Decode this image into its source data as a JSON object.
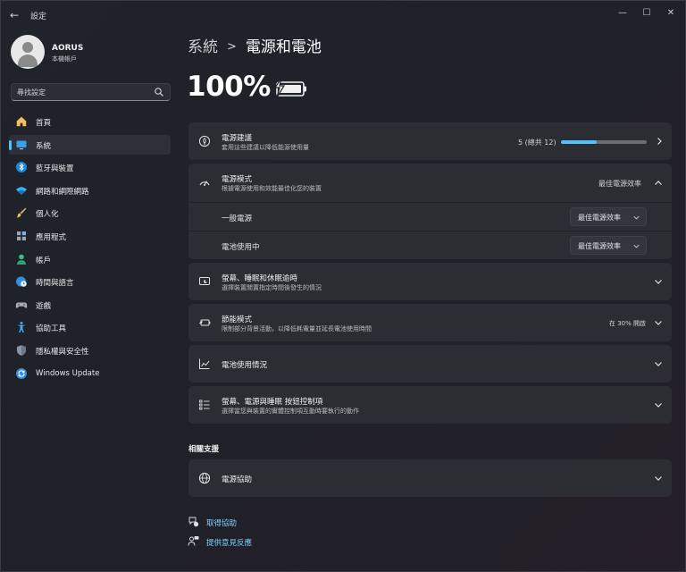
{
  "window": {
    "title": "設定",
    "back_glyph": "←",
    "min_glyph": "—",
    "max_glyph": "☐",
    "close_glyph": "✕"
  },
  "profile": {
    "name": "AORUS",
    "account": "本機帳戶"
  },
  "search": {
    "placeholder": "尋找設定"
  },
  "nav": [
    {
      "label": "首頁",
      "icon": "home-icon"
    },
    {
      "label": "系統",
      "icon": "display-icon",
      "active": true
    },
    {
      "label": "藍牙與裝置",
      "icon": "bluetooth-icon"
    },
    {
      "label": "網路和網際網路",
      "icon": "wifi-icon"
    },
    {
      "label": "個人化",
      "icon": "brush-icon"
    },
    {
      "label": "應用程式",
      "icon": "apps-icon"
    },
    {
      "label": "帳戶",
      "icon": "person-icon"
    },
    {
      "label": "時間與語言",
      "icon": "globe-clock-icon"
    },
    {
      "label": "遊戲",
      "icon": "gamepad-icon"
    },
    {
      "label": "協助工具",
      "icon": "accessibility-icon"
    },
    {
      "label": "隱私權與安全性",
      "icon": "shield-icon"
    },
    {
      "label": "Windows Update",
      "icon": "update-icon"
    }
  ],
  "breadcrumb": {
    "parent": "系統",
    "current": "電源和電池"
  },
  "battery": {
    "percent": "100%",
    "charging": true
  },
  "cards": {
    "power_recommendations": {
      "title": "電源建議",
      "subtitle": "套用這些建議以降低能源使用量",
      "count_text": "5 (總共 12)",
      "progress": 0.42
    },
    "power_mode": {
      "title": "電源模式",
      "subtitle": "根據電源使用和效能最佳化您的裝置",
      "value": "最佳電源效率",
      "rows": [
        {
          "label": "一般電源",
          "value": "最佳電源效率"
        },
        {
          "label": "電池使用中",
          "value": "最佳電源效率"
        }
      ]
    },
    "screen_sleep": {
      "title": "螢幕、睡眠和休眠逾時",
      "subtitle": "選擇裝置閒置指定時間後發生的情況"
    },
    "energy_saver": {
      "title": "節能模式",
      "subtitle": "限制部分背景活動，以降低耗電量並延長電池使用時間",
      "value": "在 30% 開啟"
    },
    "battery_usage": {
      "title": "電池使用情況"
    },
    "buttons": {
      "title": "螢幕、電源與睡眠 按鈕控制項",
      "subtitle": "選擇當您與裝置的實體控制項互動時要執行的動作"
    }
  },
  "related": {
    "title": "相關支援",
    "power_help": "電源協助"
  },
  "links": {
    "get_help": "取得協助",
    "feedback": "提供意見反應"
  },
  "colors": {
    "accent": "#4cc2ff",
    "card": "#2b2d33",
    "background": "#1f2126"
  }
}
